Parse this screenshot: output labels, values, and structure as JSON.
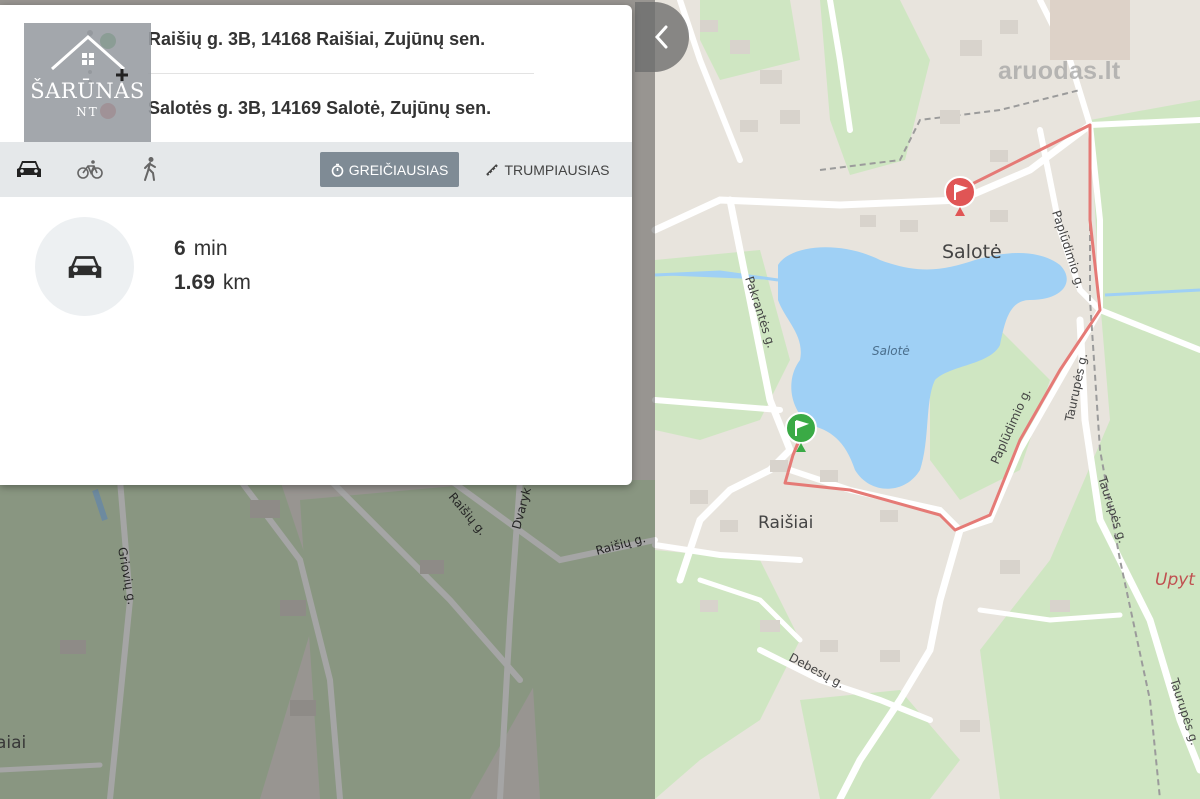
{
  "route": {
    "origin": "Raišių g. 3B, 14168 Raišiai, Zujūnų sen.",
    "destination": "Salotės g. 3B, 14169 Salotė, Zujūnų sen."
  },
  "logo": {
    "name": "ŠARŪNAS",
    "sub": "NT"
  },
  "modes": [
    "car-icon",
    "bicycle-icon",
    "walking-icon"
  ],
  "buttons": {
    "fastest": "GREIČIAUSIAS",
    "shortest": "TRUMPIAUSIAS"
  },
  "result": {
    "time_value": "6",
    "time_unit": "min",
    "distance_value": "1.69",
    "distance_unit": "km"
  },
  "watermark": "aruodas.lt",
  "map_labels": {
    "saloté_village": "Salotė",
    "lake": "Salotė",
    "raisiai_village": "Raišiai",
    "raisiai_left": "aiai",
    "uptyte": "Upyt",
    "streets": {
      "pakrantes": "Pakrantės g.",
      "paplud1": "Paplūdimio g.",
      "paplud2": "Paplūdimio g.",
      "taurupes1": "Taurupės g.",
      "taurupes2": "Taurupės g.",
      "taurupes3": "Taurupės g.",
      "raisiu1": "Raišių g.",
      "raisiu2": "Raišių g.",
      "dvaryko": "Dvaryk",
      "griovio": "Griovių g.",
      "debesu": "Debesų g."
    }
  },
  "colors": {
    "lake": "#9fd0f5",
    "route": "#e57a76",
    "park": "#cfe8c4",
    "start_marker": "#3aaa45",
    "end_marker": "#e05555",
    "fast_button": "#7f8b95"
  }
}
